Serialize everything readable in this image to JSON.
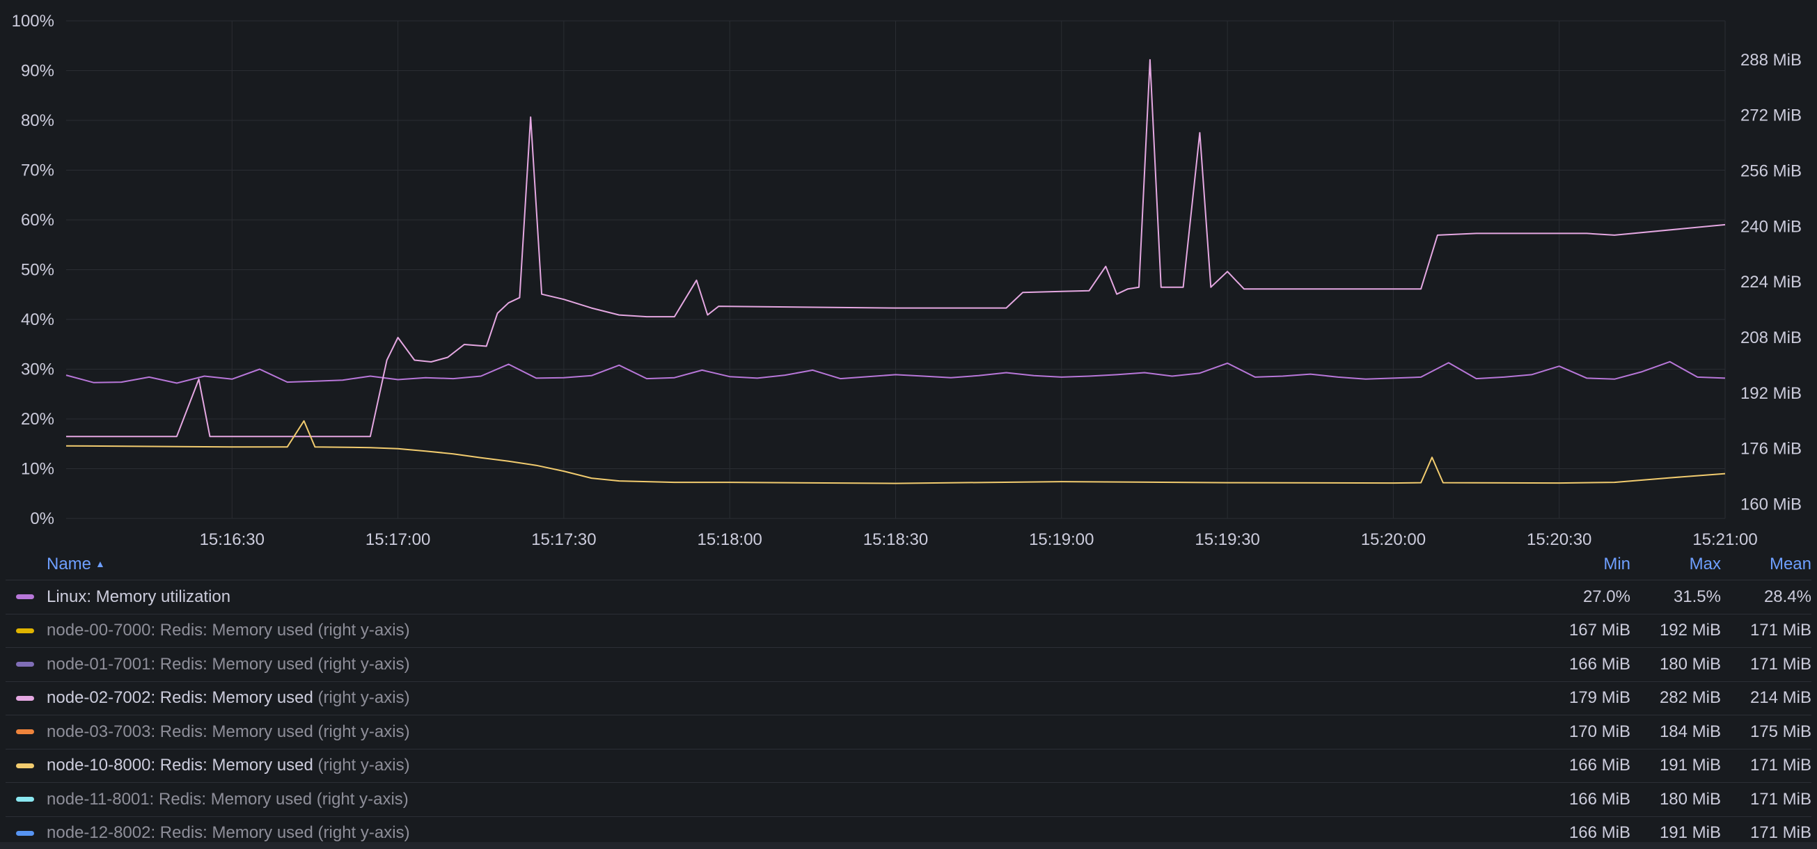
{
  "chart_data": {
    "type": "line",
    "x_ticks": [
      "15:16:30",
      "15:17:00",
      "15:17:30",
      "15:18:00",
      "15:18:30",
      "15:19:00",
      "15:19:30",
      "15:20:00",
      "15:20:30",
      "15:21:00"
    ],
    "x_range": [
      "15:16:00",
      "15:21:00"
    ],
    "y_left": {
      "ticks": [
        "100%",
        "90%",
        "80%",
        "70%",
        "60%",
        "50%",
        "40%",
        "30%",
        "20%",
        "10%",
        "0%"
      ],
      "range": [
        0,
        100
      ],
      "unit": "%"
    },
    "y_right": {
      "ticks": [
        "288 MiB",
        "272 MiB",
        "256 MiB",
        "240 MiB",
        "224 MiB",
        "208 MiB",
        "192 MiB",
        "176 MiB",
        "160 MiB"
      ],
      "range": [
        155.9,
        299.2
      ],
      "unit": "MiB"
    },
    "grid": true,
    "legend_placement": "bottom",
    "series": [
      {
        "name": "Linux: Memory utilization",
        "axis": "left",
        "color": "#b877d9",
        "points": [
          [
            "15:16:00",
            28.8
          ],
          [
            "15:16:05",
            27.3
          ],
          [
            "15:16:10",
            27.4
          ],
          [
            "15:16:15",
            28.4
          ],
          [
            "15:16:20",
            27.2
          ],
          [
            "15:16:25",
            28.6
          ],
          [
            "15:16:30",
            28.0
          ],
          [
            "15:16:35",
            30.0
          ],
          [
            "15:16:40",
            27.4
          ],
          [
            "15:16:45",
            27.6
          ],
          [
            "15:16:50",
            27.8
          ],
          [
            "15:16:55",
            28.6
          ],
          [
            "15:17:00",
            27.9
          ],
          [
            "15:17:05",
            28.3
          ],
          [
            "15:17:10",
            28.1
          ],
          [
            "15:17:15",
            28.6
          ],
          [
            "15:17:20",
            31.0
          ],
          [
            "15:17:25",
            28.2
          ],
          [
            "15:17:30",
            28.3
          ],
          [
            "15:17:35",
            28.7
          ],
          [
            "15:17:40",
            30.8
          ],
          [
            "15:17:45",
            28.1
          ],
          [
            "15:17:50",
            28.3
          ],
          [
            "15:17:55",
            29.8
          ],
          [
            "15:18:00",
            28.5
          ],
          [
            "15:18:05",
            28.2
          ],
          [
            "15:18:10",
            28.8
          ],
          [
            "15:18:15",
            29.8
          ],
          [
            "15:18:20",
            28.1
          ],
          [
            "15:18:25",
            28.5
          ],
          [
            "15:18:30",
            28.9
          ],
          [
            "15:18:35",
            28.6
          ],
          [
            "15:18:40",
            28.3
          ],
          [
            "15:18:45",
            28.7
          ],
          [
            "15:18:50",
            29.3
          ],
          [
            "15:18:55",
            28.7
          ],
          [
            "15:19:00",
            28.4
          ],
          [
            "15:19:05",
            28.6
          ],
          [
            "15:19:10",
            28.9
          ],
          [
            "15:19:15",
            29.3
          ],
          [
            "15:19:20",
            28.6
          ],
          [
            "15:19:25",
            29.2
          ],
          [
            "15:19:30",
            31.2
          ],
          [
            "15:19:35",
            28.4
          ],
          [
            "15:19:40",
            28.6
          ],
          [
            "15:19:45",
            29.0
          ],
          [
            "15:19:50",
            28.4
          ],
          [
            "15:19:55",
            28.0
          ],
          [
            "15:20:00",
            28.2
          ],
          [
            "15:20:05",
            28.4
          ],
          [
            "15:20:10",
            31.3
          ],
          [
            "15:20:15",
            28.1
          ],
          [
            "15:20:20",
            28.4
          ],
          [
            "15:20:25",
            28.9
          ],
          [
            "15:20:30",
            30.6
          ],
          [
            "15:20:35",
            28.2
          ],
          [
            "15:20:40",
            28.0
          ],
          [
            "15:20:45",
            29.5
          ],
          [
            "15:20:50",
            31.5
          ],
          [
            "15:20:55",
            28.4
          ],
          [
            "15:21:00",
            28.2
          ]
        ]
      },
      {
        "name": "node-02-7002: Redis: Memory used",
        "axis": "right",
        "color": "#e5a8e2",
        "points": [
          [
            "15:16:00",
            179.5
          ],
          [
            "15:16:20",
            179.5
          ],
          [
            "15:16:24",
            196.0
          ],
          [
            "15:16:26",
            179.5
          ],
          [
            "15:16:55",
            179.5
          ],
          [
            "15:16:58",
            201.5
          ],
          [
            "15:17:00",
            208.0
          ],
          [
            "15:17:03",
            201.5
          ],
          [
            "15:17:06",
            201.0
          ],
          [
            "15:17:09",
            202.3
          ],
          [
            "15:17:12",
            206.0
          ],
          [
            "15:17:16",
            205.5
          ],
          [
            "15:17:18",
            215.0
          ],
          [
            "15:17:20",
            218.0
          ],
          [
            "15:17:22",
            219.5
          ],
          [
            "15:17:24",
            271.5
          ],
          [
            "15:17:26",
            220.5
          ],
          [
            "15:17:30",
            219.0
          ],
          [
            "15:17:35",
            216.5
          ],
          [
            "15:17:40",
            214.5
          ],
          [
            "15:17:45",
            214.0
          ],
          [
            "15:17:50",
            214.0
          ],
          [
            "15:17:54",
            224.5
          ],
          [
            "15:17:56",
            214.5
          ],
          [
            "15:17:58",
            217.0
          ],
          [
            "15:18:30",
            216.5
          ],
          [
            "15:18:50",
            216.5
          ],
          [
            "15:18:53",
            221.0
          ],
          [
            "15:19:05",
            221.5
          ],
          [
            "15:19:08",
            228.5
          ],
          [
            "15:19:10",
            220.5
          ],
          [
            "15:19:12",
            222.0
          ],
          [
            "15:19:14",
            222.5
          ],
          [
            "15:19:16",
            288.0
          ],
          [
            "15:19:18",
            222.5
          ],
          [
            "15:19:22",
            222.5
          ],
          [
            "15:19:25",
            267.0
          ],
          [
            "15:19:27",
            222.5
          ],
          [
            "15:19:30",
            227.0
          ],
          [
            "15:19:33",
            222.0
          ],
          [
            "15:19:50",
            222.0
          ],
          [
            "15:20:05",
            222.0
          ],
          [
            "15:20:08",
            237.5
          ],
          [
            "15:20:15",
            238.0
          ],
          [
            "15:20:35",
            238.0
          ],
          [
            "15:20:40",
            237.5
          ],
          [
            "15:21:00",
            240.5
          ]
        ]
      },
      {
        "name": "node-10-8000: Redis: Memory used",
        "axis": "right",
        "color": "#f2cc6f",
        "points": [
          [
            "15:16:00",
            176.8
          ],
          [
            "15:16:30",
            176.5
          ],
          [
            "15:16:40",
            176.5
          ],
          [
            "15:16:43",
            184.0
          ],
          [
            "15:16:45",
            176.5
          ],
          [
            "15:16:55",
            176.3
          ],
          [
            "15:17:00",
            176.0
          ],
          [
            "15:17:05",
            175.3
          ],
          [
            "15:17:10",
            174.5
          ],
          [
            "15:17:15",
            173.4
          ],
          [
            "15:17:20",
            172.4
          ],
          [
            "15:17:25",
            171.2
          ],
          [
            "15:17:30",
            169.5
          ],
          [
            "15:17:35",
            167.5
          ],
          [
            "15:17:40",
            166.7
          ],
          [
            "15:17:50",
            166.3
          ],
          [
            "15:18:00",
            166.3
          ],
          [
            "15:18:30",
            166.0
          ],
          [
            "15:19:00",
            166.5
          ],
          [
            "15:19:30",
            166.2
          ],
          [
            "15:20:00",
            166.1
          ],
          [
            "15:20:05",
            166.2
          ],
          [
            "15:20:07",
            173.5
          ],
          [
            "15:20:09",
            166.2
          ],
          [
            "15:20:30",
            166.1
          ],
          [
            "15:20:40",
            166.3
          ],
          [
            "15:20:50",
            167.6
          ],
          [
            "15:21:00",
            168.8
          ]
        ]
      }
    ]
  },
  "legend": {
    "headers": {
      "name": "Name",
      "sort_glyph": "▲",
      "min": "Min",
      "max": "Max",
      "mean": "Mean"
    },
    "rows": [
      {
        "series": "Linux: Memory utilization",
        "axis_note": "",
        "color": "#b877d9",
        "muted": false,
        "min": "27.0%",
        "max": "31.5%",
        "mean": "28.4%"
      },
      {
        "series": "node-00-7000: Redis: Memory used",
        "axis_note": "(right y-axis)",
        "color": "#e0b400",
        "muted": true,
        "min": "167 MiB",
        "max": "192 MiB",
        "mean": "171 MiB"
      },
      {
        "series": "node-01-7001: Redis: Memory used",
        "axis_note": "(right y-axis)",
        "color": "#806eb7",
        "muted": true,
        "min": "166 MiB",
        "max": "180 MiB",
        "mean": "171 MiB"
      },
      {
        "series": "node-02-7002: Redis: Memory used",
        "axis_note": "(right y-axis)",
        "color": "#e5a8e2",
        "muted": false,
        "min": "179 MiB",
        "max": "282 MiB",
        "mean": "214 MiB"
      },
      {
        "series": "node-03-7003: Redis: Memory used",
        "axis_note": "(right y-axis)",
        "color": "#ef843c",
        "muted": true,
        "min": "170 MiB",
        "max": "184 MiB",
        "mean": "175 MiB"
      },
      {
        "series": "node-10-8000: Redis: Memory used",
        "axis_note": "(right y-axis)",
        "color": "#f2cc6f",
        "muted": false,
        "min": "166 MiB",
        "max": "191 MiB",
        "mean": "171 MiB"
      },
      {
        "series": "node-11-8001: Redis: Memory used",
        "axis_note": "(right y-axis)",
        "color": "#8ae7f0",
        "muted": true,
        "min": "166 MiB",
        "max": "180 MiB",
        "mean": "171 MiB"
      },
      {
        "series": "node-12-8002: Redis: Memory used",
        "axis_note": "(right y-axis)",
        "color": "#5794f2",
        "muted": true,
        "min": "166 MiB",
        "max": "191 MiB",
        "mean": "171 MiB"
      }
    ]
  }
}
